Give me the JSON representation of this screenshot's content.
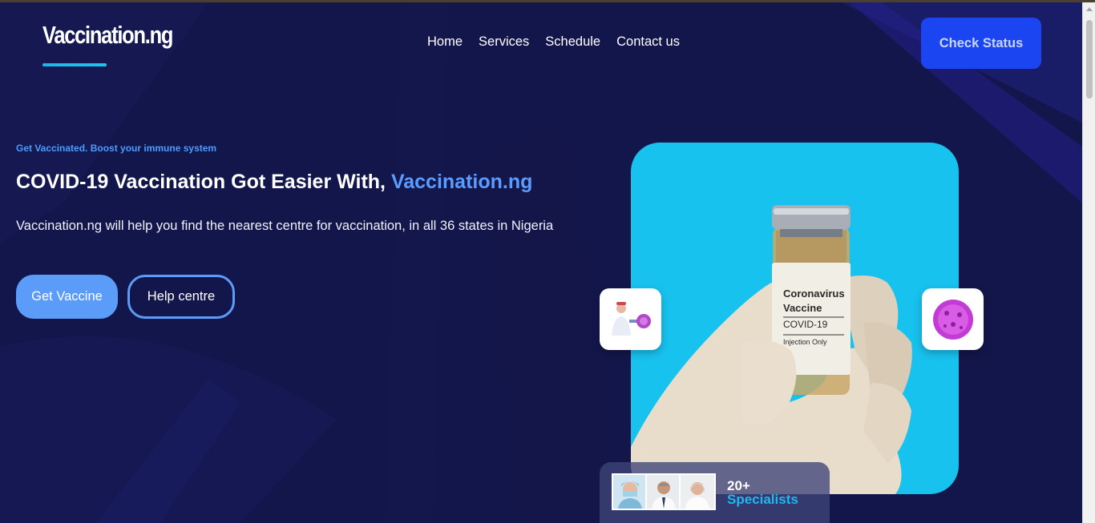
{
  "header": {
    "logo": "Vaccination.ng",
    "nav": [
      "Home",
      "Services",
      "Schedule",
      "Contact us"
    ],
    "cta": "Check Status"
  },
  "hero": {
    "tagline": "Get Vaccinated. Boost your immune system",
    "headline_prefix": "COVID-19 Vaccination Got Easier With, ",
    "headline_brand": "Vaccination.ng",
    "description": "Vaccination.ng will help you find the nearest centre for vaccination, in all 36 states in Nigeria",
    "primary_button": "Get Vaccine",
    "secondary_button": "Help centre"
  },
  "hero_image": {
    "vial_label_line1": "Coronavirus",
    "vial_label_line2": "Vaccine",
    "vial_label_line3": "COVID-19",
    "vial_label_line4": "Injection Only",
    "left_card_icon": "doctor-virus-icon",
    "right_card_icon": "virus-icon"
  },
  "specialists": {
    "count": "20+",
    "label": "Specialists"
  },
  "colors": {
    "background": "#13164a",
    "accent_blue": "#5b9cf9",
    "cta_blue": "#1a45f0",
    "cyan": "#18c2ee"
  }
}
